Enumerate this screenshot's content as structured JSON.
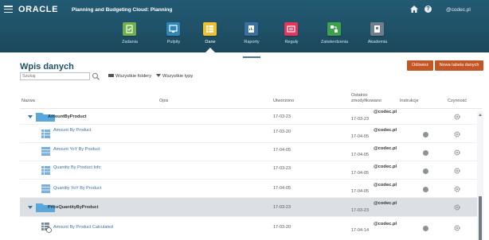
{
  "header": {
    "brand": "ORACLE",
    "product": "Planning and Budgeting Cloud: Planning",
    "user": "@codec.pl",
    "menu_icon": "hamburger-icon",
    "home_icon": "home-icon",
    "help_icon": "help-icon",
    "help_glyph": "?"
  },
  "nav": {
    "items": [
      {
        "label": "Zadania",
        "icon": "tasks-icon",
        "color": "#6fb04a"
      },
      {
        "label": "Pulpity",
        "icon": "dashboards-icon",
        "color": "#2f86b8"
      },
      {
        "label": "Dane",
        "icon": "data-icon",
        "color": "#f0c12f"
      },
      {
        "label": "Raporty",
        "icon": "reports-icon",
        "color": "#3b6f9e"
      },
      {
        "label": "Reguły",
        "icon": "rules-icon",
        "color": "#e2365b"
      },
      {
        "label": "Zatwierdzenia",
        "icon": "approvals-icon",
        "color": "#3ea24c"
      },
      {
        "label": "Akademia",
        "icon": "academy-icon",
        "color": "#6e7f8d"
      }
    ],
    "active": "Dane"
  },
  "page": {
    "title": "Wpis danych",
    "search_placeholder": "Szukaj",
    "filter_folders": "Wszystkie foldery",
    "filter_types": "Wszystkie typy",
    "refresh_label": "Odśwież",
    "new_form_label": "Nowa tabela danych"
  },
  "table": {
    "columns": {
      "name": "Nazwa",
      "description": "Opis",
      "created": "Utworzono",
      "modified_line1": "Ostatnio",
      "modified_line2": "zmodyfikowano",
      "instructions": "Instrukcje",
      "actions": "Czynność"
    },
    "rows": [
      {
        "type": "folder",
        "name": "AmountByProduct",
        "created": "17-03-23",
        "modified_user": "@codec.pl",
        "modified_date": "17-03-23"
      },
      {
        "type": "form",
        "name": "Amount By Product",
        "created": "17-03-20",
        "modified_user": "@codec.pl",
        "modified_date": "17-04-05"
      },
      {
        "type": "form",
        "name": "Amount YoY By Product",
        "created": "17-04-05",
        "modified_user": "@codec.pl",
        "modified_date": "17-04-05"
      },
      {
        "type": "form",
        "name": "Quantity By Product Info",
        "created": "17-03-23",
        "modified_user": "@codec.pl",
        "modified_date": "17-04-05"
      },
      {
        "type": "form",
        "name": "Quantity YoY By Product",
        "created": "17-04-05",
        "modified_user": "@codec.pl",
        "modified_date": "17-04-05"
      },
      {
        "type": "folder",
        "name": "PriceQuantityByProduct",
        "created": "17-03-23",
        "modified_user": "@codec.pl",
        "modified_date": "17-03-23"
      },
      {
        "type": "form-calc",
        "name": "Amount By Product Calculated",
        "created": "17-03-20",
        "modified_user": "@codec.pl",
        "modified_date": "17-04-14"
      }
    ]
  }
}
